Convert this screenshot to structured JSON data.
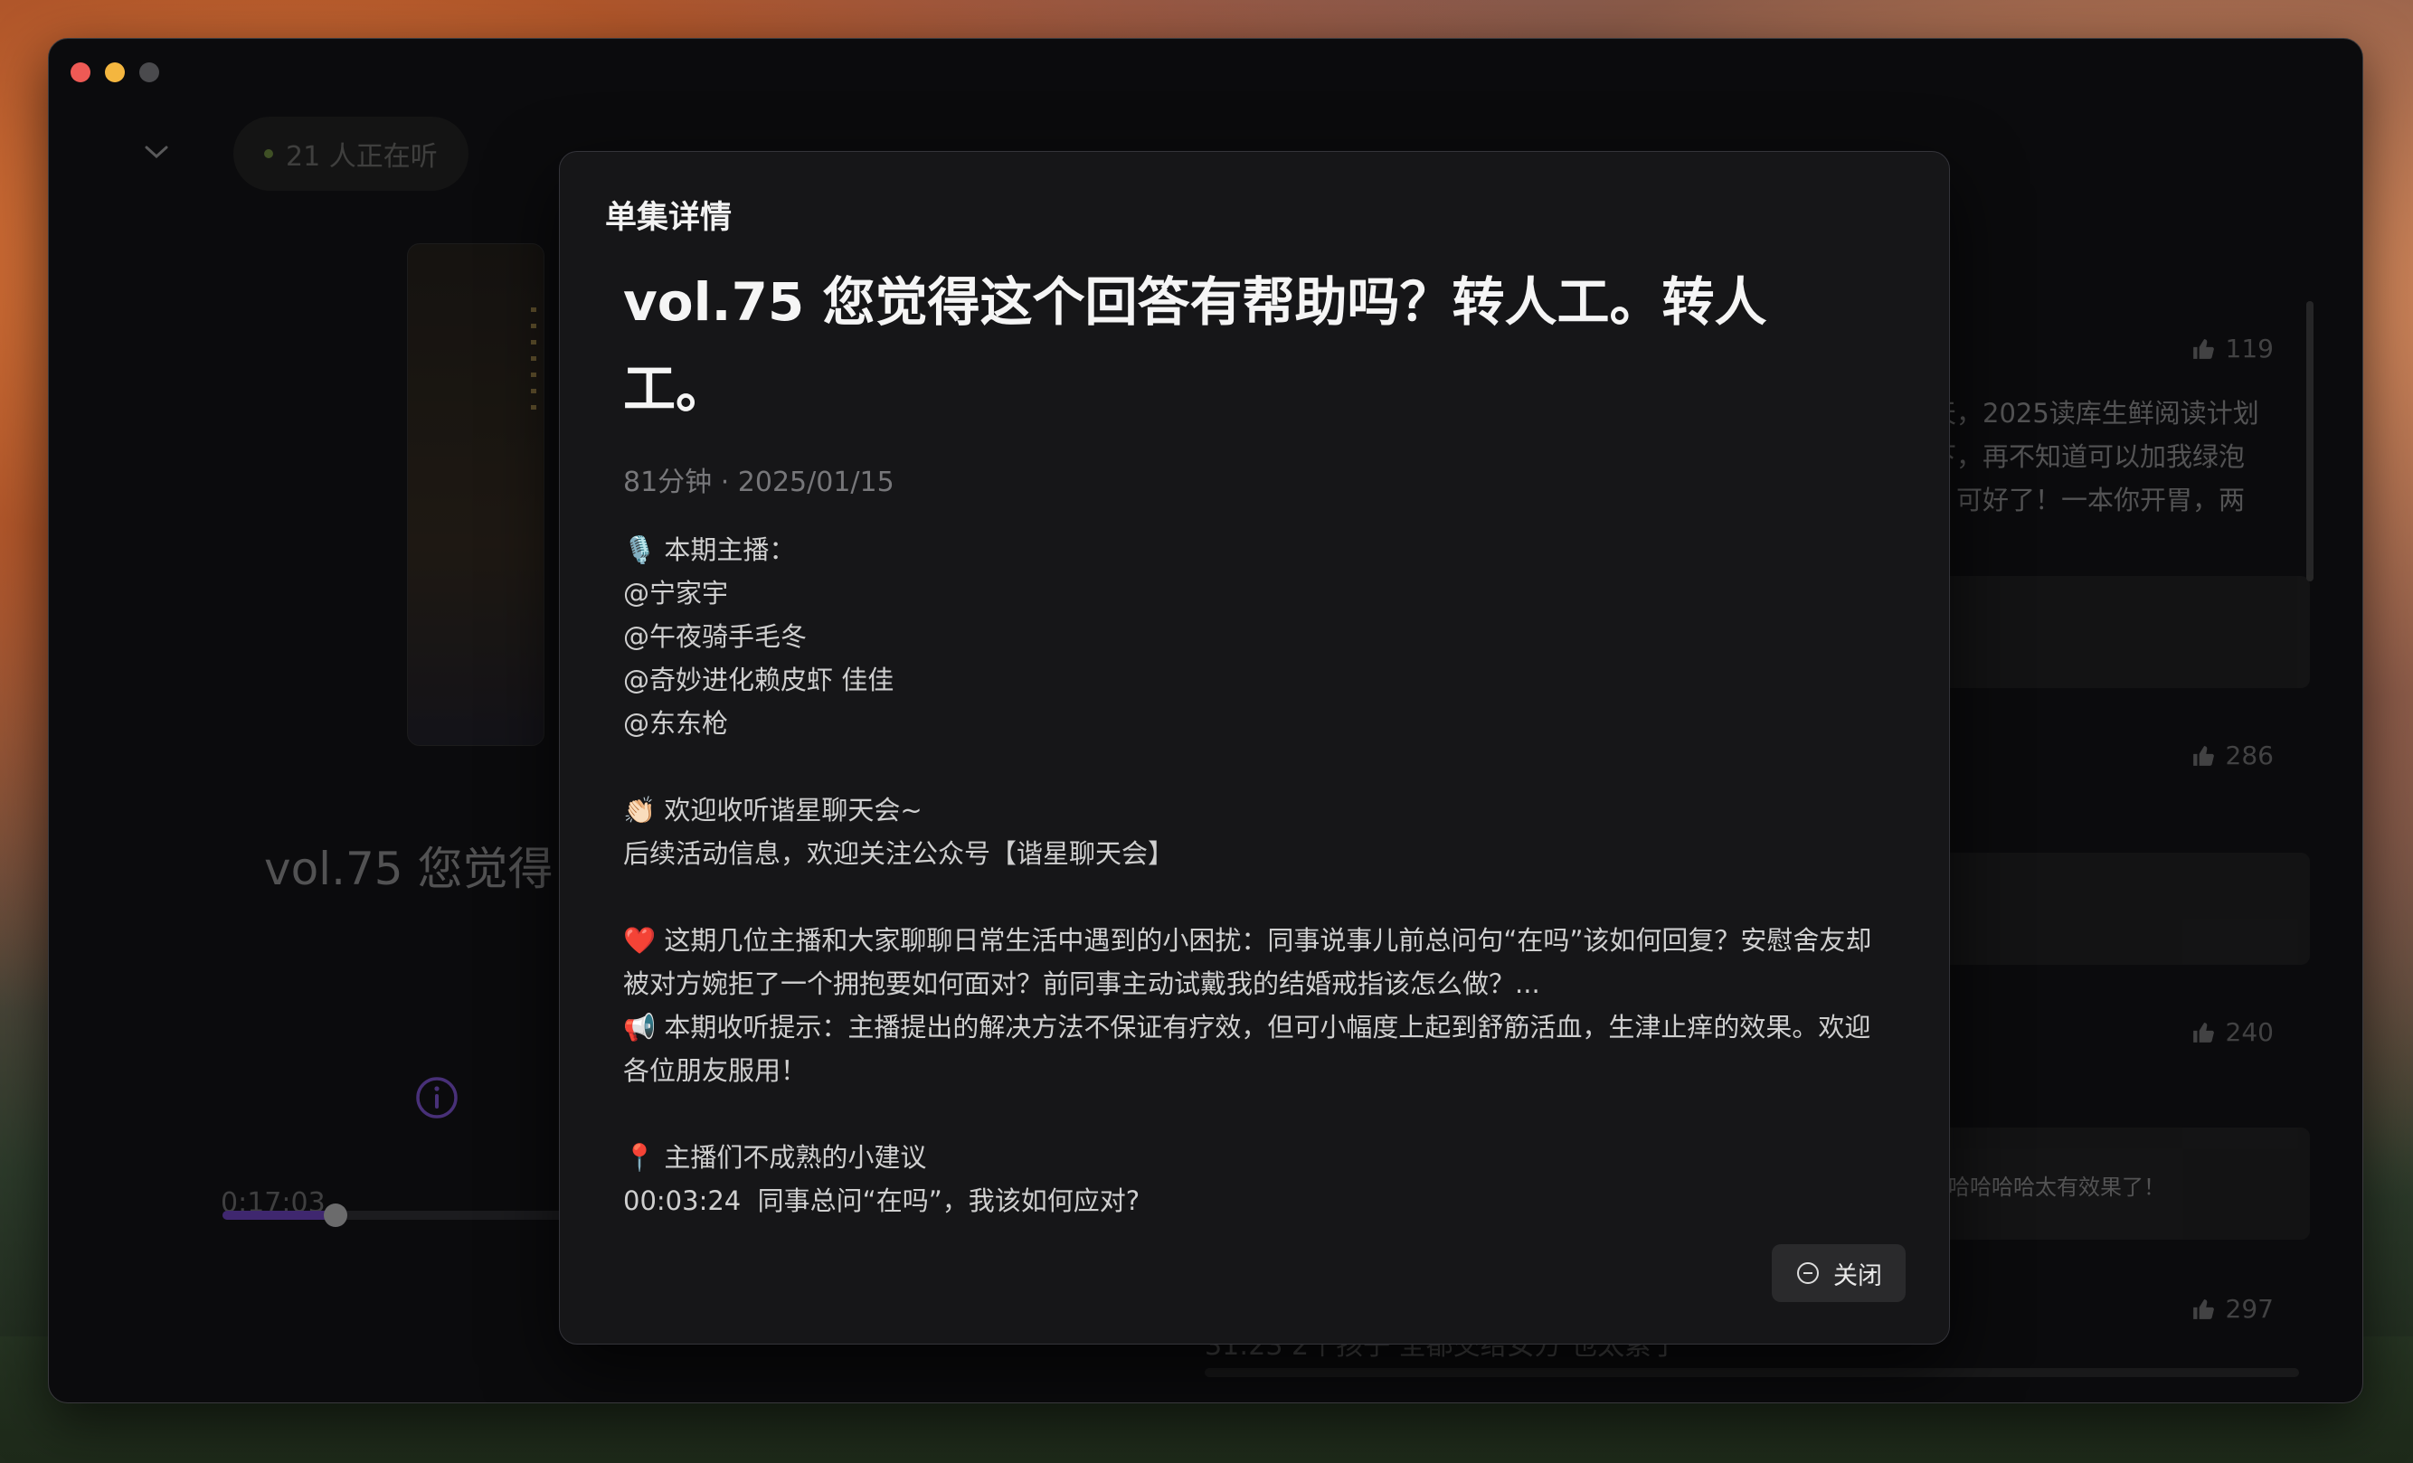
{
  "listening": {
    "label": "21 人正在听"
  },
  "player": {
    "title_truncated": "vol.75 您觉得",
    "current_time": "0:17:03",
    "progress_fraction": 0.33
  },
  "comments": [
    {
      "likes": "119",
      "text": "天，2025读库生鲜阅读计划\n下，再不知道可以加我绿泡\n，可好了！一本你开胃，两"
    },
    {
      "likes": "286"
    },
    {
      "likes": "240",
      "reply": "哈哈哈哈太有效果了！",
      "fragment": "!"
    },
    {
      "likes": "297"
    }
  ],
  "footer_comment": "31:23 2个孩子 全都交给女方 也太累了",
  "modal": {
    "header": "单集详情",
    "episode_title": "vol.75 您觉得这个回答有帮助吗？转人工。转人工。",
    "meta": "81分钟 · 2025/01/15",
    "description_lines": [
      "🎙️ 本期主播：",
      "@宁家宇",
      "@午夜骑手毛冬",
      "@奇妙进化赖皮虾 佳佳",
      "@东东枪",
      "",
      "👏🏻 欢迎收听谐星聊天会~",
      "后续活动信息，欢迎关注公众号【谐星聊天会】",
      "",
      "❤️ 这期几位主播和大家聊聊日常生活中遇到的小困扰：同事说事儿前总问句“在吗”该如何回复？安慰舍友却被对方婉拒了一个拥抱要如何面对？前同事主动试戴我的结婚戒指该怎么做？...",
      "📢 本期收听提示：主播提出的解决方法不保证有疗效，但可小幅度上起到舒筋活血，生津止痒的效果。欢迎各位朋友服用！",
      "",
      "📍 主播们不成熟的小建议",
      "00:03:24  同事总问“在吗”，我该如何应对?"
    ],
    "close_label": "关闭"
  }
}
